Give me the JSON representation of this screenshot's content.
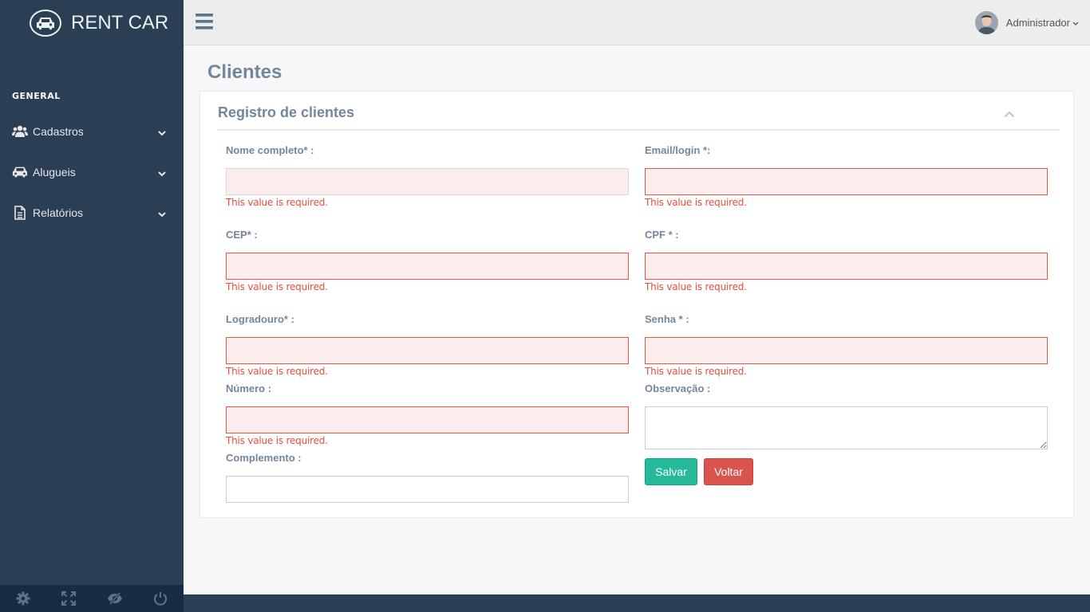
{
  "brand": {
    "title": "RENT CAR"
  },
  "sidebar": {
    "section_title": "GENERAL",
    "items": [
      {
        "label": "Cadastros",
        "icon": "users-icon"
      },
      {
        "label": "Alugueis",
        "icon": "car-icon"
      },
      {
        "label": "Relatórios",
        "icon": "document-icon"
      }
    ],
    "footer": [
      "settings-icon",
      "fullscreen-icon",
      "eye-slash-icon",
      "power-icon"
    ]
  },
  "topnav": {
    "user_name": "Administrador"
  },
  "page": {
    "title": "Clientes"
  },
  "panel": {
    "title": "Registro de clientes",
    "fields": {
      "nome": {
        "label": "Nome completo* :",
        "value": "",
        "error": "This value is required."
      },
      "email": {
        "label": "Email/login *:",
        "value": "",
        "error": "This value is required."
      },
      "cep": {
        "label": "CEP* :",
        "value": "",
        "error": "This value is required."
      },
      "cpf": {
        "label": "CPF * :",
        "value": "",
        "error": "This value is required."
      },
      "logradouro": {
        "label": "Logradouro* :",
        "value": "",
        "error": "This value is required."
      },
      "senha": {
        "label": "Senha * :",
        "value": "",
        "error": "This value is required."
      },
      "numero": {
        "label": "Número :",
        "value": "",
        "error": "This value is required."
      },
      "observacao": {
        "label": "Observação :",
        "value": ""
      },
      "complemento": {
        "label": "Complemento :",
        "value": ""
      }
    },
    "buttons": {
      "save": "Salvar",
      "back": "Voltar"
    }
  },
  "colors": {
    "sidebar": "#2A3F54",
    "accent_green": "#26B99A",
    "danger": "#D9534F",
    "error_text": "#E74C3C"
  }
}
